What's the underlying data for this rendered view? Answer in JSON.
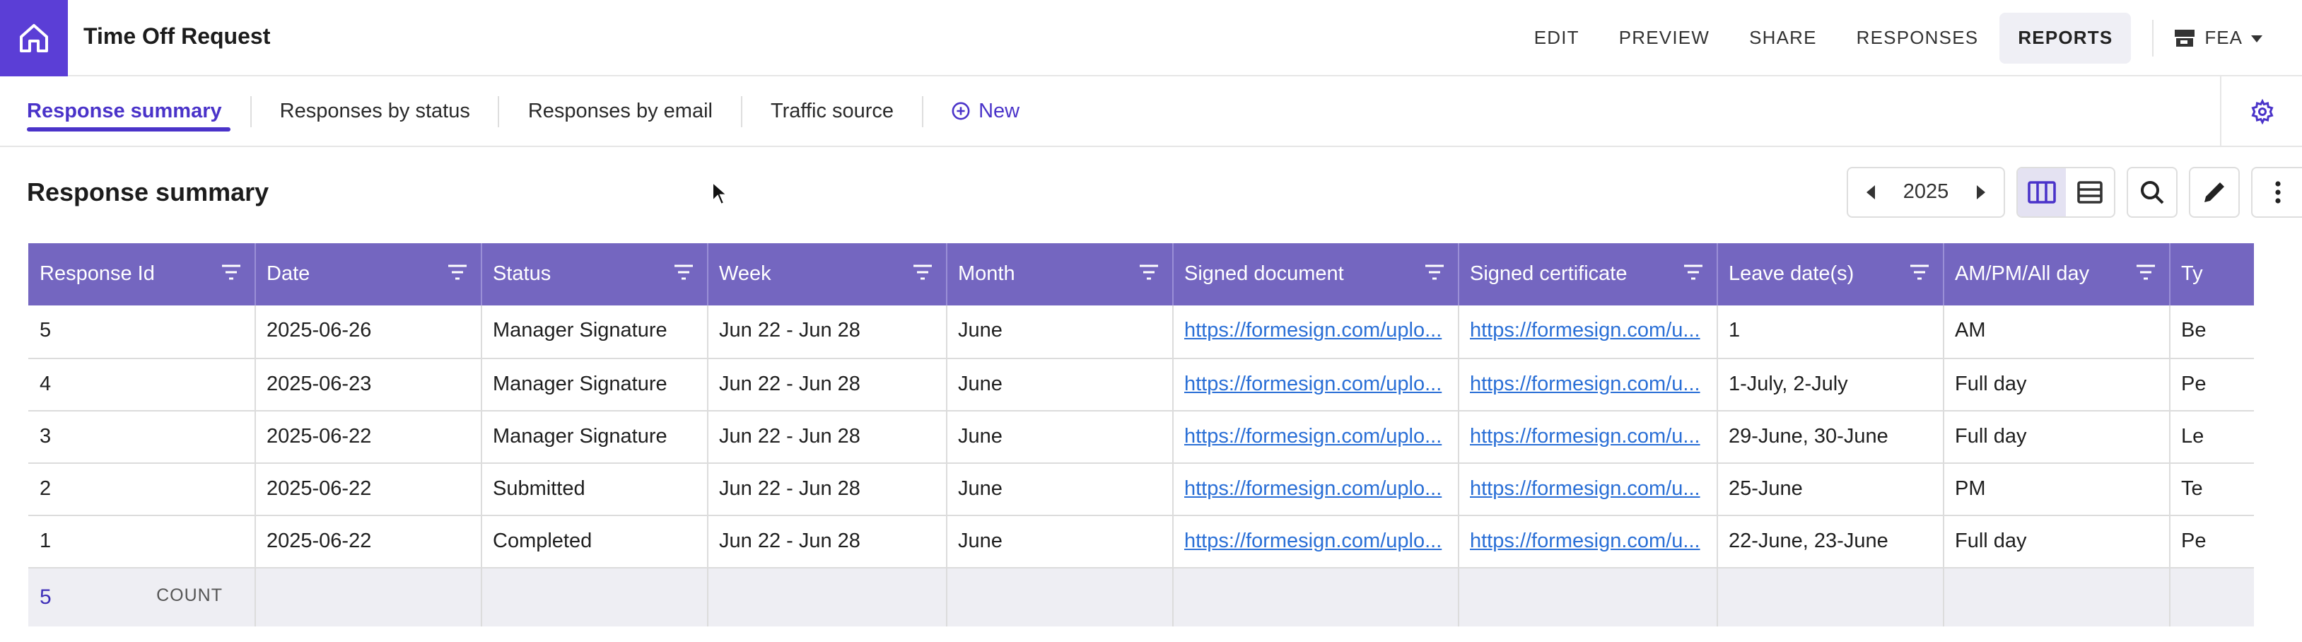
{
  "app": {
    "title": "Time Off Request"
  },
  "topnav": {
    "items": [
      {
        "label": "EDIT",
        "active": false
      },
      {
        "label": "PREVIEW",
        "active": false
      },
      {
        "label": "SHARE",
        "active": false
      },
      {
        "label": "RESPONSES",
        "active": false
      },
      {
        "label": "REPORTS",
        "active": true
      }
    ],
    "org_label": "FEA"
  },
  "tabs": {
    "items": [
      {
        "label": "Response summary",
        "active": true
      },
      {
        "label": "Responses by status",
        "active": false
      },
      {
        "label": "Responses by email",
        "active": false
      },
      {
        "label": "Traffic source",
        "active": false
      }
    ],
    "new_label": "New"
  },
  "toolbar": {
    "title": "Response summary",
    "year": "2025"
  },
  "table": {
    "columns": [
      "Response Id",
      "Date",
      "Status",
      "Week",
      "Month",
      "Signed document",
      "Signed certificate",
      "Leave date(s)",
      "AM/PM/All day",
      "Ty"
    ],
    "rows": [
      [
        "5",
        "2025-06-26",
        "Manager Signature",
        "Jun 22 - Jun 28",
        "June",
        "https://formesign.com/uplo...",
        "https://formesign.com/u...",
        "1",
        "AM",
        "Be"
      ],
      [
        "4",
        "2025-06-23",
        "Manager Signature",
        "Jun 22 - Jun 28",
        "June",
        "https://formesign.com/uplo...",
        "https://formesign.com/u...",
        "1-July, 2-July",
        "Full day",
        "Pe"
      ],
      [
        "3",
        "2025-06-22",
        "Manager Signature",
        "Jun 22 - Jun 28",
        "June",
        "https://formesign.com/uplo...",
        "https://formesign.com/u...",
        "29-June, 30-June",
        "Full day",
        "Le"
      ],
      [
        "2",
        "2025-06-22",
        "Submitted",
        "Jun 22 - Jun 28",
        "June",
        "https://formesign.com/uplo...",
        "https://formesign.com/u...",
        "25-June",
        "PM",
        "Te"
      ],
      [
        "1",
        "2025-06-22",
        "Completed",
        "Jun 22 - Jun 28",
        "June",
        "https://formesign.com/uplo...",
        "https://formesign.com/u...",
        "22-June, 23-June",
        "Full day",
        "Pe"
      ]
    ],
    "footer": {
      "count": "5",
      "count_label": "COUNT"
    }
  },
  "colors": {
    "accent": "#5b3ed6",
    "header": "#7466c0",
    "link": "#2a6fd6"
  }
}
